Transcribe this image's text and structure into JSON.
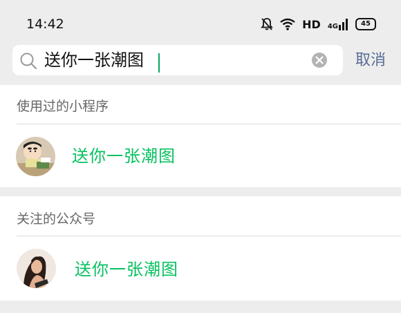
{
  "status_bar": {
    "time": "14:42",
    "network_label": "HD",
    "signal_label": "4G",
    "battery_level": "45"
  },
  "search": {
    "query": "送你一张潮图",
    "cancel_label": "取消"
  },
  "mini_programs": {
    "title": "使用过的小程序",
    "items": [
      {
        "label": "送你一张潮图",
        "avatar_icon": "cartoon-boy-avatar"
      }
    ]
  },
  "official_accounts": {
    "title": "关注的公众号",
    "items": [
      {
        "label": "送你一张潮图",
        "avatar_icon": "woman-photo-avatar"
      }
    ]
  },
  "colors": {
    "accent_green": "#07c160",
    "cancel_blue": "#576b95",
    "background": "#ededed"
  }
}
